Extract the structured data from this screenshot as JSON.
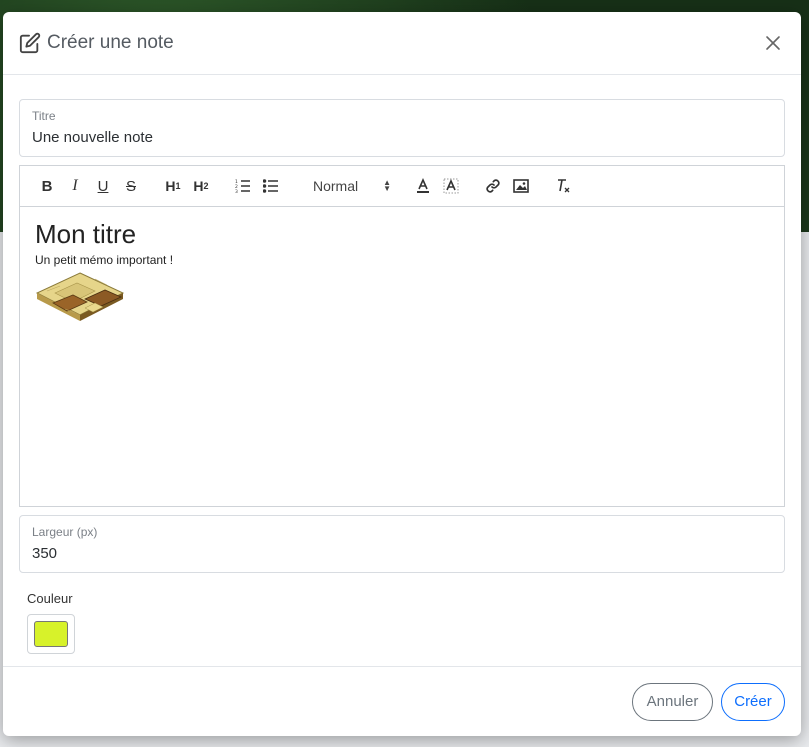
{
  "modal": {
    "title": "Créer une note",
    "title_icon": "edit-icon",
    "close_icon": "close-icon"
  },
  "fields": {
    "title": {
      "label": "Titre",
      "value": "Une nouvelle note"
    },
    "width": {
      "label": "Largeur (px)",
      "value": "350"
    }
  },
  "toolbar": {
    "bold": "B",
    "italic": "I",
    "underline": "U",
    "strike": "S",
    "h1": "H",
    "h1_sub": "1",
    "h2": "H",
    "h2_sub": "2",
    "format_select": "Normal",
    "icons": [
      "ordered-list-icon",
      "bullet-list-icon",
      "text-color-icon",
      "background-color-icon",
      "link-icon",
      "image-icon",
      "clear-format-icon"
    ]
  },
  "editor": {
    "heading": "Mon titre",
    "paragraph": "Un petit mémo important !",
    "image_icon": "floor-tile-image"
  },
  "color": {
    "label": "Couleur",
    "value": "#d7f22a"
  },
  "footer": {
    "cancel": "Annuler",
    "create": "Créer"
  }
}
